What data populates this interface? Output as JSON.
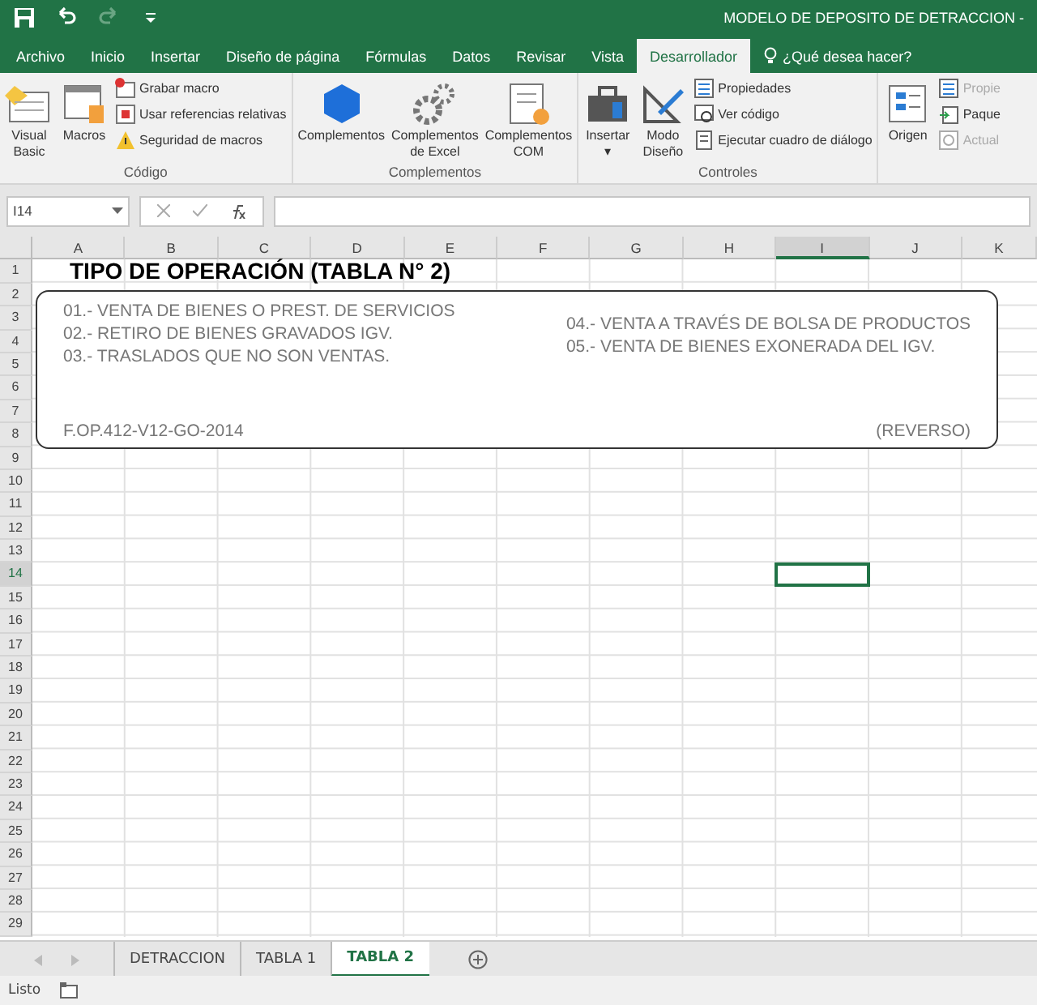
{
  "window": {
    "title": "MODELO DE DEPOSITO DE DETRACCION -"
  },
  "menu_tabs": [
    {
      "label": "Archivo",
      "selected": false
    },
    {
      "label": "Inicio",
      "selected": false
    },
    {
      "label": "Insertar",
      "selected": false
    },
    {
      "label": "Diseño de página",
      "selected": false
    },
    {
      "label": "Fórmulas",
      "selected": false
    },
    {
      "label": "Datos",
      "selected": false
    },
    {
      "label": "Revisar",
      "selected": false
    },
    {
      "label": "Vista",
      "selected": false
    },
    {
      "label": "Desarrollador",
      "selected": true
    }
  ],
  "tell_me": "¿Qué desea hacer?",
  "ribbon_groups": [
    {
      "name": "Código",
      "large": [
        {
          "label": "Visual\nBasic",
          "kind": "vb"
        },
        {
          "label": "Macros",
          "kind": "macros"
        }
      ],
      "small": [
        {
          "label": "Grabar macro",
          "kind": "record",
          "disabled": false
        },
        {
          "label": "Usar referencias relativas",
          "kind": "relative",
          "disabled": false
        },
        {
          "label": "Seguridad de macros",
          "kind": "warning",
          "disabled": false
        }
      ]
    },
    {
      "name": "Complementos",
      "large": [
        {
          "label": "Complementos",
          "kind": "cube"
        },
        {
          "label": "Complementos\nde Excel",
          "kind": "gears"
        },
        {
          "label": "Complementos\nCOM",
          "kind": "com"
        }
      ]
    },
    {
      "name": "Controles",
      "large": [
        {
          "label": "Insertar\n▾",
          "kind": "toolbox"
        },
        {
          "label": "Modo\nDiseño",
          "kind": "design"
        }
      ],
      "small": [
        {
          "label": "Propiedades",
          "kind": "props",
          "disabled": false
        },
        {
          "label": "Ver código",
          "kind": "code",
          "disabled": false
        },
        {
          "label": "Ejecutar cuadro de diálogo",
          "kind": "dialog",
          "disabled": false
        }
      ]
    },
    {
      "large": [
        {
          "label": "Origen",
          "kind": "source"
        }
      ],
      "small": [
        {
          "label": "Propie",
          "kind": "props",
          "disabled": true
        },
        {
          "label": "Paque",
          "kind": "package",
          "disabled": false
        },
        {
          "label": "Actual",
          "kind": "refresh",
          "disabled": true
        }
      ]
    }
  ],
  "name_box": "I14",
  "columns": [
    {
      "label": "A",
      "selected": false
    },
    {
      "label": "B",
      "selected": false
    },
    {
      "label": "C",
      "selected": false
    },
    {
      "label": "D",
      "selected": false
    },
    {
      "label": "E",
      "selected": false
    },
    {
      "label": "F",
      "selected": false
    },
    {
      "label": "G",
      "selected": false
    },
    {
      "label": "H",
      "selected": false
    },
    {
      "label": "I",
      "selected": true
    },
    {
      "label": "J",
      "selected": false
    },
    {
      "label": "K",
      "selected": false
    }
  ],
  "rows": [
    {
      "label": "1",
      "selected": false
    },
    {
      "label": "2",
      "selected": false
    },
    {
      "label": "3",
      "selected": false
    },
    {
      "label": "4",
      "selected": false
    },
    {
      "label": "5",
      "selected": false
    },
    {
      "label": "6",
      "selected": false
    },
    {
      "label": "7",
      "selected": false
    },
    {
      "label": "8",
      "selected": false
    },
    {
      "label": "9",
      "selected": false
    },
    {
      "label": "10",
      "selected": false
    },
    {
      "label": "11",
      "selected": false
    },
    {
      "label": "12",
      "selected": false
    },
    {
      "label": "13",
      "selected": false
    },
    {
      "label": "14",
      "selected": true
    },
    {
      "label": "15",
      "selected": false
    },
    {
      "label": "16",
      "selected": false
    },
    {
      "label": "17",
      "selected": false
    },
    {
      "label": "18",
      "selected": false
    },
    {
      "label": "19",
      "selected": false
    },
    {
      "label": "20",
      "selected": false
    },
    {
      "label": "21",
      "selected": false
    },
    {
      "label": "22",
      "selected": false
    },
    {
      "label": "23",
      "selected": false
    },
    {
      "label": "24",
      "selected": false
    },
    {
      "label": "25",
      "selected": false
    },
    {
      "label": "26",
      "selected": false
    },
    {
      "label": "27",
      "selected": false
    },
    {
      "label": "28",
      "selected": false
    },
    {
      "label": "29",
      "selected": false
    }
  ],
  "sheet": {
    "title": "TIPO DE OPERACIÓN (TABLA N° 2)",
    "left_items": [
      "01.- VENTA DE BIENES O PREST. DE SERVICIOS",
      "02.- RETIRO DE BIENES GRAVADOS IGV.",
      "03.- TRASLADOS QUE NO SON VENTAS."
    ],
    "right_items": [
      "04.- VENTA A TRAVÉS DE BOLSA DE PRODUCTOS",
      "05.- VENTA DE BIENES EXONERADA DEL IGV."
    ],
    "code": "F.OP.412-V12-GO-2014",
    "side": "(REVERSO)"
  },
  "sheet_tabs": [
    {
      "label": "DETRACCION",
      "selected": false
    },
    {
      "label": "TABLA 1",
      "selected": false
    },
    {
      "label": "TABLA 2",
      "selected": true
    }
  ],
  "status_bar": {
    "text": "Listo"
  }
}
